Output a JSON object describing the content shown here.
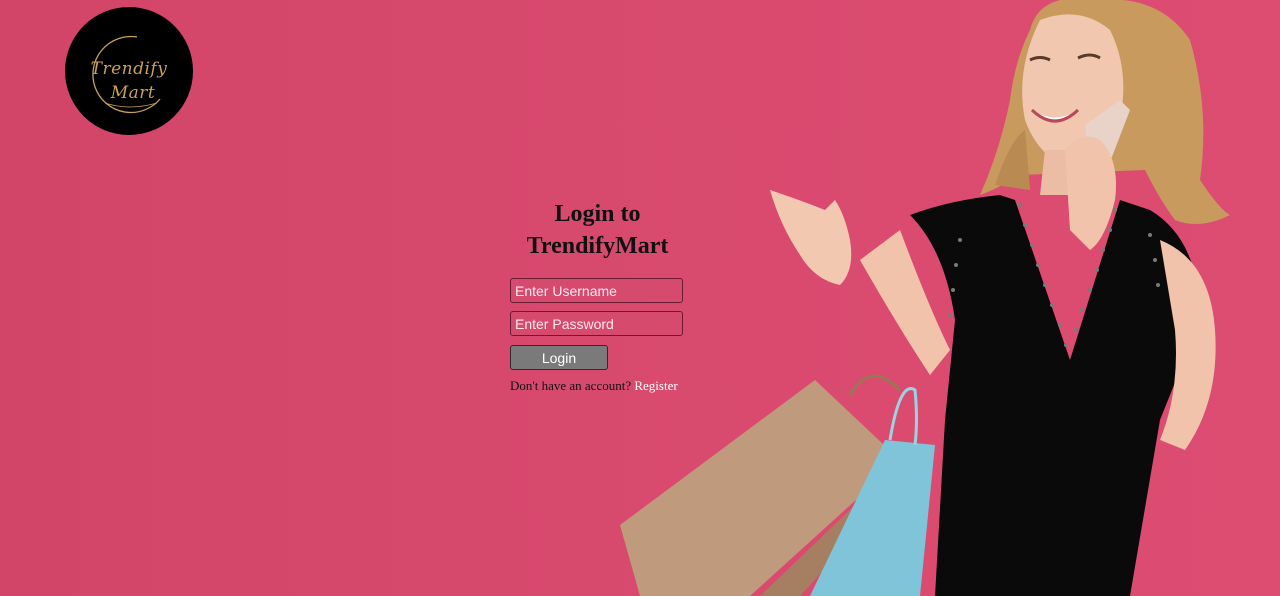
{
  "brand": {
    "logo_line1": "Trendify",
    "logo_line2": "Mart"
  },
  "login": {
    "title_line1": "Login to",
    "title_line2": "TrendifyMart",
    "username_placeholder": "Enter Username",
    "password_placeholder": "Enter Password",
    "button_label": "Login",
    "no_account_text": "Don't have an account?",
    "register_label": "Register"
  },
  "colors": {
    "background": "#d5466b",
    "logo_bg": "#000000",
    "logo_gold": "#c9a15a",
    "button_bg": "#7a7a7a",
    "link": "#ffffff"
  }
}
